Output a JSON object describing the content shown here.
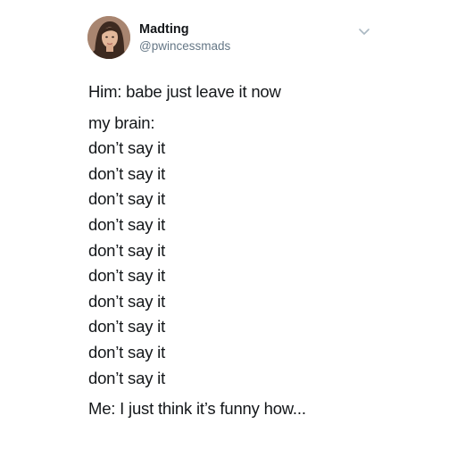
{
  "author": {
    "display_name": "Madting",
    "handle": "@pwincessmads",
    "avatar_icon": "profile-photo"
  },
  "menu": {
    "icon": "chevron-down-icon",
    "color": "#aab8c2"
  },
  "tweet": {
    "line_1": "Him: babe just leave it now",
    "line_2": "my brain:",
    "repeats": [
      "don’t say it",
      "don’t say it",
      "don’t say it",
      "don’t say it",
      "don’t say it",
      "don’t say it",
      "don’t say it",
      "don’t say it",
      "don’t say it",
      "don’t say it"
    ],
    "final_line": "Me: I just think it’s funny how..."
  },
  "colors": {
    "text": "#14171a",
    "secondary": "#657786",
    "background": "#ffffff"
  }
}
